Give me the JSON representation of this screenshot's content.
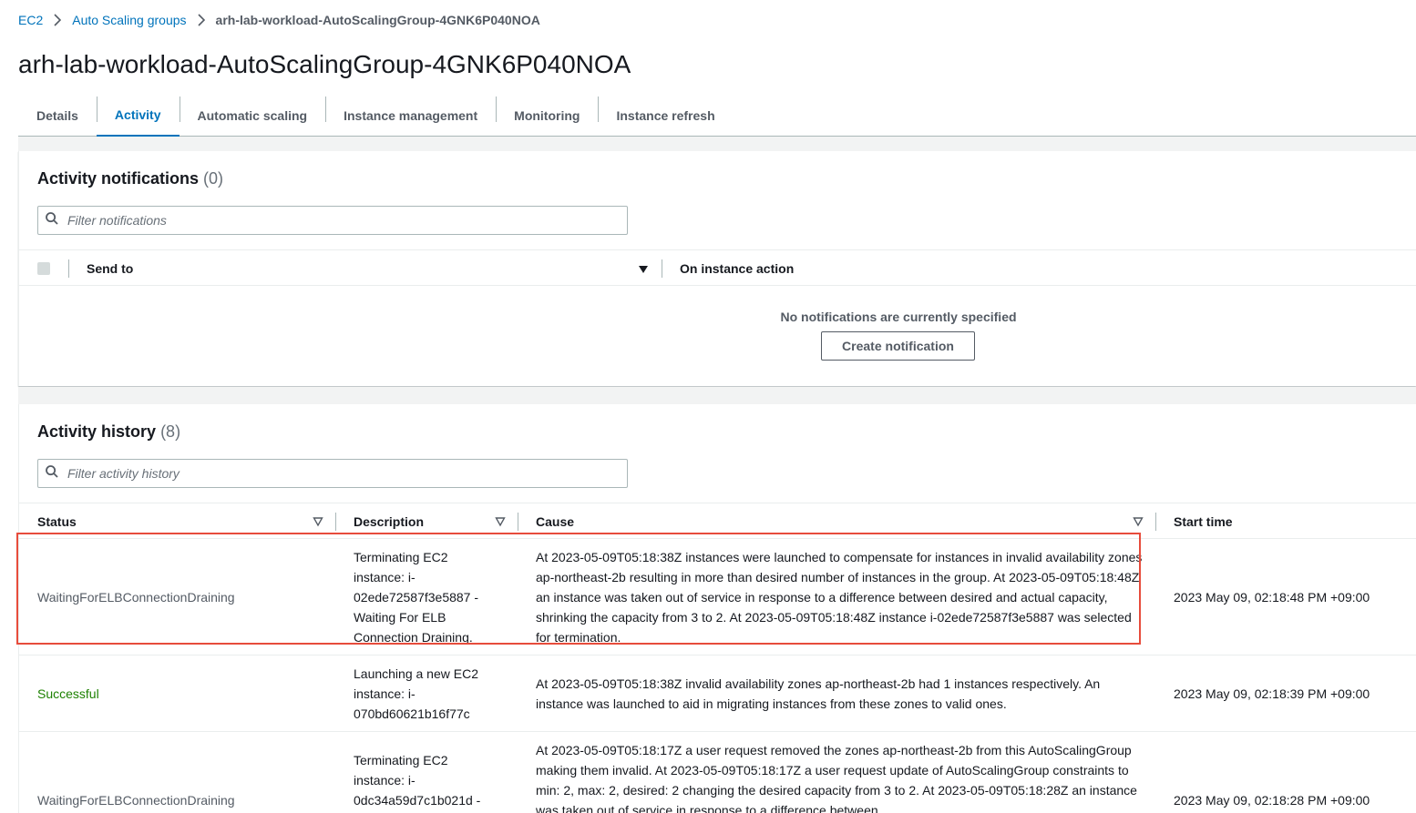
{
  "breadcrumb": {
    "items": [
      "EC2",
      "Auto Scaling groups"
    ],
    "current": "arh-lab-workload-AutoScalingGroup-4GNK6P040NOA"
  },
  "page": {
    "title": "arh-lab-workload-AutoScalingGroup-4GNK6P040NOA"
  },
  "tabs": [
    {
      "label": "Details"
    },
    {
      "label": "Activity"
    },
    {
      "label": "Automatic scaling"
    },
    {
      "label": "Instance management"
    },
    {
      "label": "Monitoring"
    },
    {
      "label": "Instance refresh"
    }
  ],
  "active_tab": "Activity",
  "notifications": {
    "title": "Activity notifications",
    "count": "(0)",
    "filter_placeholder": "Filter notifications",
    "columns": [
      "Send to",
      "On instance action"
    ],
    "empty_text": "No notifications are currently specified",
    "create_button": "Create notification"
  },
  "history": {
    "title": "Activity history",
    "count": "(8)",
    "filter_placeholder": "Filter activity history",
    "columns": [
      "Status",
      "Description",
      "Cause",
      "Start time"
    ],
    "rows": [
      {
        "status": "WaitingForELBConnectionDraining",
        "description": "Terminating EC2 instance: i-02ede72587f3e5887 - Waiting For ELB Connection Draining.",
        "cause": "At 2023-05-09T05:18:38Z instances were launched to compensate for instances in invalid availability zones ap-northeast-2b resulting in more than desired number of instances in the group. At 2023-05-09T05:18:48Z an instance was taken out of service in response to a difference between desired and actual capacity, shrinking the capacity from 3 to 2. At 2023-05-09T05:18:48Z instance i-02ede72587f3e5887 was selected for termination.",
        "start_time": "2023 May 09, 02:18:48 PM +09:00"
      },
      {
        "status": "Successful",
        "description": "Launching a new EC2 instance: i-070bd60621b16f77c",
        "cause": "At 2023-05-09T05:18:38Z invalid availability zones ap-northeast-2b had 1 instances respectively. An instance was launched to aid in migrating instances from these zones to valid ones.",
        "start_time": "2023 May 09, 02:18:39 PM +09:00"
      },
      {
        "status": "WaitingForELBConnectionDraining",
        "description": "Terminating EC2 instance: i-0dc34a59d7c1b021d -",
        "cause": "At 2023-05-09T05:18:17Z a user request removed the zones ap-northeast-2b from this AutoScalingGroup making them invalid. At 2023-05-09T05:18:17Z a user request update of AutoScalingGroup constraints to min: 2, max: 2, desired: 2 changing the desired capacity from 3 to 2. At 2023-05-09T05:18:28Z an instance was taken out of service in response to a difference between",
        "start_time": "2023 May 09, 02:18:28 PM +09:00"
      }
    ]
  },
  "colors": {
    "link": "#0073bb",
    "success": "#1d8102",
    "highlight": "#e74c3c"
  }
}
